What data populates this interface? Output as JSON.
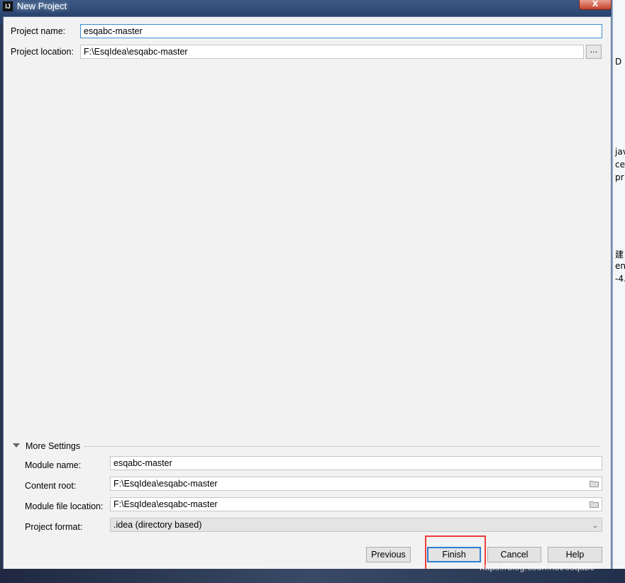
{
  "window": {
    "title": "New Project",
    "app_icon_text": "IJ",
    "close_label": "X"
  },
  "form": {
    "project_name_label": "Project name:",
    "project_name_value": "esqabc-master",
    "project_location_label": "Project location:",
    "project_location_value": "F:\\EsqIdea\\esqabc-master",
    "browse_label": "..."
  },
  "more_settings": {
    "title": "More Settings",
    "module_name_label": "Module name:",
    "module_name_value": "esqabc-master",
    "content_root_label": "Content root:",
    "content_root_value": "F:\\EsqIdea\\esqabc-master",
    "module_file_location_label": "Module file location:",
    "module_file_location_value": "F:\\EsqIdea\\esqabc-master",
    "project_format_label": "Project format:",
    "project_format_value": ".idea (directory based)"
  },
  "buttons": {
    "previous": "Previous",
    "finish": "Finish",
    "cancel": "Cancel",
    "help": "Help"
  },
  "background_window": {
    "lines": [
      "D",
      "jav",
      "ces",
      "pr",
      "建",
      "en",
      "-4."
    ]
  },
  "watermark": "https://blog.csdn.net/esqabc",
  "colors": {
    "focus_border": "#3b8fd8",
    "highlight_box": "#ef3b3b",
    "default_button_border": "#2e7fd1"
  }
}
